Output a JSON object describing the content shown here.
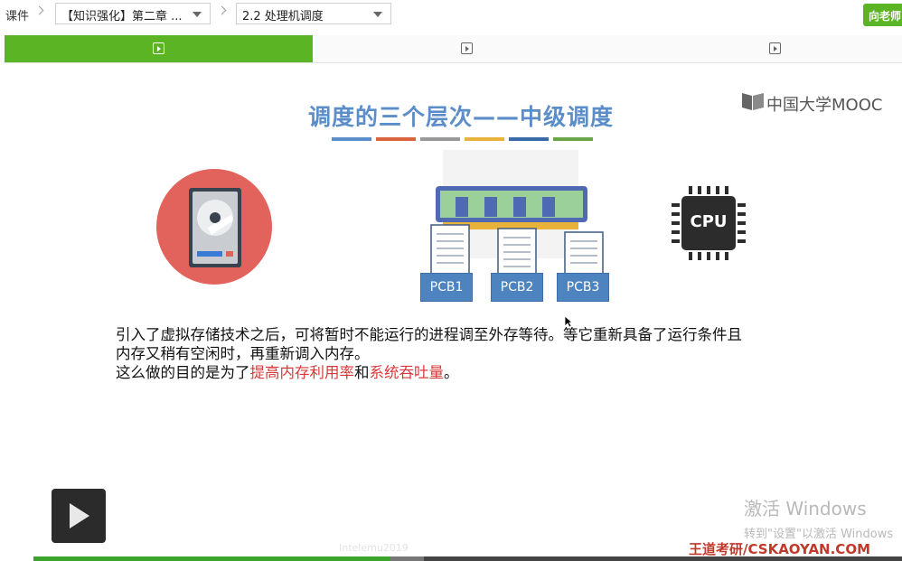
{
  "breadcrumb": {
    "root": "课件",
    "chapter_select": "【知识强化】第二章 ...",
    "lesson_select": "2.2 处理机调度"
  },
  "teacher_button": "向老师",
  "tabs": [
    {
      "active": true,
      "icon": "play-square-icon"
    },
    {
      "active": false,
      "icon": "play-square-icon"
    },
    {
      "active": false,
      "icon": "play-square-icon"
    }
  ],
  "slide": {
    "title": "调度的三个层次——中级调度",
    "title_bar_colors": [
      "#5b8ec9",
      "#d9643d",
      "#999999",
      "#e8b23b",
      "#3b6aa8",
      "#6aa547"
    ],
    "logo_text": "中国大学MOOC",
    "pcb_labels": [
      "PCB1",
      "PCB2",
      "PCB3"
    ],
    "cpu_label": "CPU",
    "body_line1": "引入了虚拟存储技术之后，可将暂时不能运行的进程调至外存等待。等它重新具备了运行条件且",
    "body_line2": "内存又稍有空闲时，再重新调入内存。",
    "body_line3_prefix": "这么做的目的是为了",
    "body_line3_hl1": "提高内存利用率",
    "body_line3_mid": "和",
    "body_line3_hl2": "系统吞吐量",
    "body_line3_suffix": "。"
  },
  "video": {
    "progress_fraction": 0.41,
    "buffered_fraction": 0.45,
    "faint_text": "Intelemu2019"
  },
  "activate_windows": {
    "line1": "激活 Windows",
    "line2": "转到\"设置\"以激活 Windows"
  },
  "watermark": "王道考研/CSKAOYAN.COM",
  "colors": {
    "accent_green": "#5bb423",
    "title_blue": "#5b8ec9",
    "highlight_red": "#d9383a"
  }
}
